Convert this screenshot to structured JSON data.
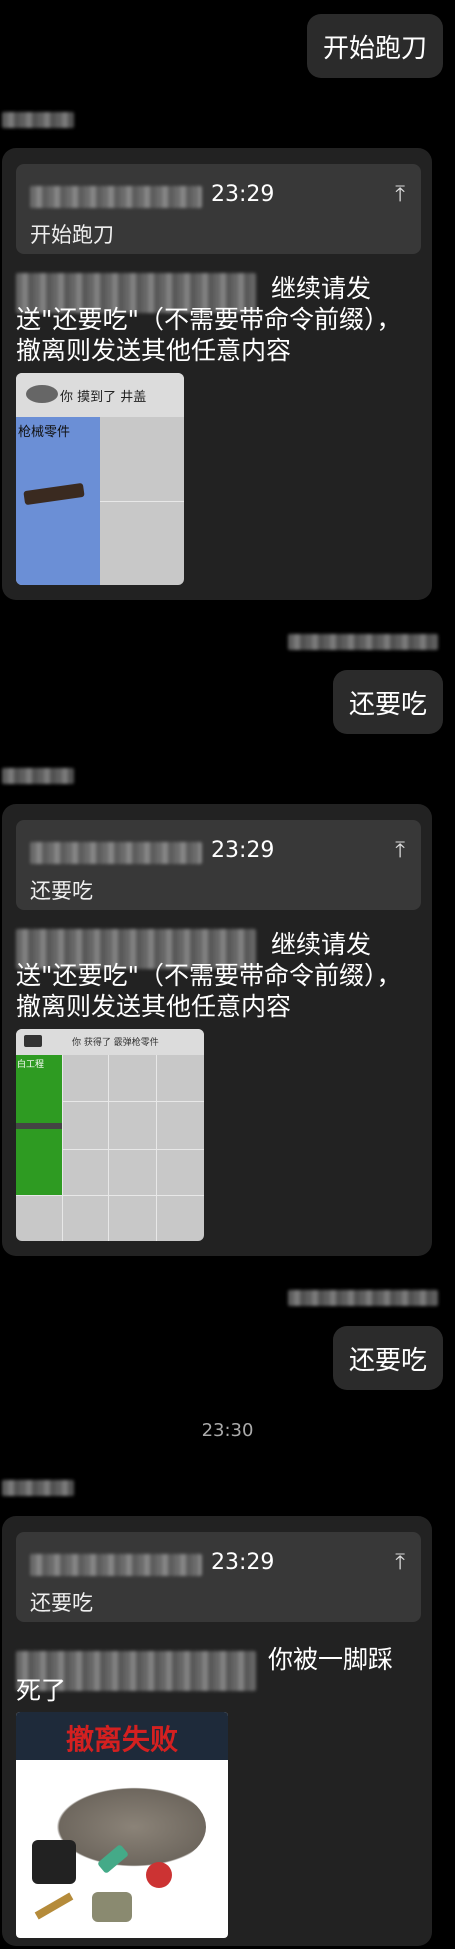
{
  "messages": [
    {
      "type": "outgoing",
      "text": "开始跑刀"
    },
    {
      "type": "incoming",
      "quote_time": "23:29",
      "quote_text": "开始跑刀",
      "text": "继续请发送\"还要吃\"（不需要带命令前缀），撤离则发送其他任意内容",
      "image": {
        "caption": "你 摸到了 井盖",
        "item_label": "枪械零件"
      }
    },
    {
      "type": "outgoing",
      "text": "还要吃"
    },
    {
      "type": "incoming",
      "quote_time": "23:29",
      "quote_text": "还要吃",
      "text": "继续请发送\"还要吃\"（不需要带命令前缀），撤离则发送其他任意内容",
      "image": {
        "caption": "你 获得了 霰弹枪零件",
        "item_label": "白工程"
      }
    },
    {
      "type": "outgoing",
      "text": "还要吃"
    },
    {
      "type": "timestamp",
      "text": "23:30"
    },
    {
      "type": "incoming",
      "quote_time": "23:29",
      "quote_text": "还要吃",
      "text": "你被一脚踩死了",
      "image": {
        "banner": "撤离失败"
      }
    }
  ],
  "colors": {
    "background": "#000000",
    "bubble": "#2b2b2b",
    "card": "#222222",
    "quote": "#383838",
    "banner_red": "#d42020"
  }
}
